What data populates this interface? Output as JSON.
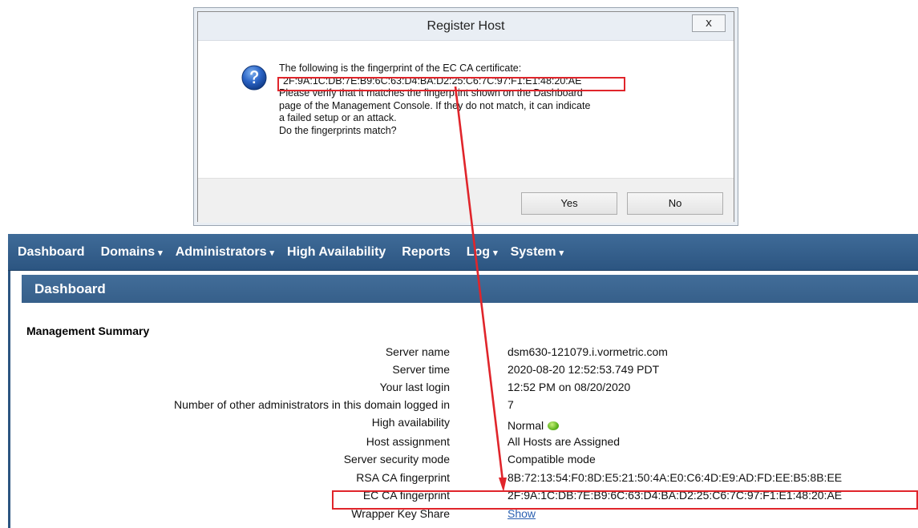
{
  "dialog": {
    "title": "Register Host",
    "close_glyph": "x",
    "icon": "question-icon",
    "message_lines": [
      "The following is the fingerprint of the EC CA certificate:",
      "2F:9A:1C:DB:7E:B9:6C:63:D4:BA:D2:25:C6:7C:97:F1:E1:48:20:AE",
      "Please verify that it matches the fingerprint shown on the Dashboard",
      "page of the Management Console. If they do not match, it can indicate",
      "a failed setup or an attack.",
      "Do the fingerprints match?"
    ],
    "yes_label": "Yes",
    "no_label": "No"
  },
  "navbar": {
    "items": [
      {
        "label": "Dashboard",
        "dropdown": ""
      },
      {
        "label": "Domains",
        "dropdown": "▾"
      },
      {
        "label": "Administrators",
        "dropdown": "▾"
      },
      {
        "label": "High Availability",
        "dropdown": ""
      },
      {
        "label": "Reports",
        "dropdown": ""
      },
      {
        "label": "Log",
        "dropdown": "▾"
      },
      {
        "label": "System",
        "dropdown": "▾"
      }
    ]
  },
  "dashboard": {
    "header": "Dashboard",
    "summary_title": "Management Summary",
    "rows": [
      {
        "label": "Server name",
        "value": "dsm630-121079.i.vormetric.com"
      },
      {
        "label": "Server time",
        "value": "2020-08-20 12:52:53.749 PDT"
      },
      {
        "label": "Your last login",
        "value": "12:52 PM on 08/20/2020"
      },
      {
        "label": "Number of other administrators in this domain logged in",
        "value": "7"
      },
      {
        "label": "High availability",
        "value": "Normal"
      },
      {
        "label": "Host assignment",
        "value": "All Hosts are Assigned"
      },
      {
        "label": "Server security mode",
        "value": "Compatible mode"
      },
      {
        "label": "RSA CA fingerprint",
        "value": "8B:72:13:54:F0:8D:E5:21:50:4A:E0:C6:4D:E9:AD:FD:EE:B5:8B:EE"
      },
      {
        "label": "EC CA fingerprint",
        "value": "2F:9A:1C:DB:7E:B9:6C:63:D4:BA:D2:25:C6:7C:97:F1:E1:48:20:AE"
      },
      {
        "label": "Wrapper Key Share",
        "value": "Show"
      }
    ]
  },
  "colors": {
    "nav_bg": "#2c5581",
    "highlight": "#e0252b",
    "link": "#2a5fb0",
    "status_ok": "#5fb51f"
  }
}
